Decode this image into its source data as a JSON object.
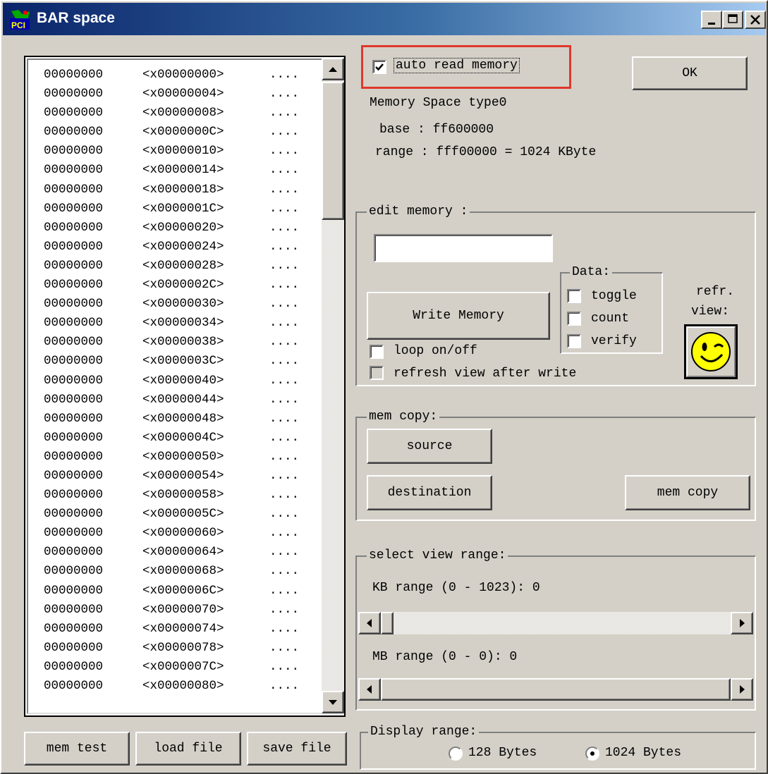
{
  "window": {
    "title": "BAR space"
  },
  "memory_list": {
    "rows": [
      {
        "value": "00000000",
        "address": "<x00000000>",
        "ascii": "...."
      },
      {
        "value": "00000000",
        "address": "<x00000004>",
        "ascii": "...."
      },
      {
        "value": "00000000",
        "address": "<x00000008>",
        "ascii": "...."
      },
      {
        "value": "00000000",
        "address": "<x0000000C>",
        "ascii": "...."
      },
      {
        "value": "00000000",
        "address": "<x00000010>",
        "ascii": "...."
      },
      {
        "value": "00000000",
        "address": "<x00000014>",
        "ascii": "...."
      },
      {
        "value": "00000000",
        "address": "<x00000018>",
        "ascii": "...."
      },
      {
        "value": "00000000",
        "address": "<x0000001C>",
        "ascii": "...."
      },
      {
        "value": "00000000",
        "address": "<x00000020>",
        "ascii": "...."
      },
      {
        "value": "00000000",
        "address": "<x00000024>",
        "ascii": "...."
      },
      {
        "value": "00000000",
        "address": "<x00000028>",
        "ascii": "...."
      },
      {
        "value": "00000000",
        "address": "<x0000002C>",
        "ascii": "...."
      },
      {
        "value": "00000000",
        "address": "<x00000030>",
        "ascii": "...."
      },
      {
        "value": "00000000",
        "address": "<x00000034>",
        "ascii": "...."
      },
      {
        "value": "00000000",
        "address": "<x00000038>",
        "ascii": "...."
      },
      {
        "value": "00000000",
        "address": "<x0000003C>",
        "ascii": "...."
      },
      {
        "value": "00000000",
        "address": "<x00000040>",
        "ascii": "...."
      },
      {
        "value": "00000000",
        "address": "<x00000044>",
        "ascii": "...."
      },
      {
        "value": "00000000",
        "address": "<x00000048>",
        "ascii": "...."
      },
      {
        "value": "00000000",
        "address": "<x0000004C>",
        "ascii": "...."
      },
      {
        "value": "00000000",
        "address": "<x00000050>",
        "ascii": "...."
      },
      {
        "value": "00000000",
        "address": "<x00000054>",
        "ascii": "...."
      },
      {
        "value": "00000000",
        "address": "<x00000058>",
        "ascii": "...."
      },
      {
        "value": "00000000",
        "address": "<x0000005C>",
        "ascii": "...."
      },
      {
        "value": "00000000",
        "address": "<x00000060>",
        "ascii": "...."
      },
      {
        "value": "00000000",
        "address": "<x00000064>",
        "ascii": "...."
      },
      {
        "value": "00000000",
        "address": "<x00000068>",
        "ascii": "...."
      },
      {
        "value": "00000000",
        "address": "<x0000006C>",
        "ascii": "...."
      },
      {
        "value": "00000000",
        "address": "<x00000070>",
        "ascii": "...."
      },
      {
        "value": "00000000",
        "address": "<x00000074>",
        "ascii": "...."
      },
      {
        "value": "00000000",
        "address": "<x00000078>",
        "ascii": "...."
      },
      {
        "value": "00000000",
        "address": "<x0000007C>",
        "ascii": "...."
      },
      {
        "value": "00000000",
        "address": "<x00000080>",
        "ascii": "...."
      }
    ]
  },
  "bottom_buttons": {
    "mem_test": "mem test",
    "load_file": "load file",
    "save_file": "save file"
  },
  "options": {
    "auto_read_label": "auto read memory",
    "auto_read_checked": true,
    "ok_label": "OK"
  },
  "info": {
    "space_type": "Memory Space type0",
    "base": "base : ff600000",
    "range": "range : fff00000 = 1024 KByte"
  },
  "edit_memory": {
    "group_label": "edit memory :",
    "input_value": "",
    "write_button": "Write Memory",
    "loop_label": "loop on/off",
    "refresh_label": "refresh view after write",
    "data_group_label": "Data:",
    "toggle_label": "toggle",
    "count_label": "count",
    "verify_label": "verify",
    "refr_label_1": "refr.",
    "refr_label_2": "view:"
  },
  "mem_copy": {
    "group_label": "mem copy:",
    "source_button": "source",
    "destination_button": "destination",
    "copy_button": "mem copy"
  },
  "view_range": {
    "group_label": "select view range:",
    "kb_label": "KB range (0 - 1023): 0",
    "mb_label": "MB range (0 - 0): 0",
    "kb_value": 0,
    "mb_value": 0
  },
  "display_range": {
    "group_label": "Display range:",
    "option_128": "128 Bytes",
    "option_1024": "1024 Bytes",
    "selected": "1024 Bytes"
  },
  "colors": {
    "highlight_box": "#e0372c",
    "title_bar_start": "#0a246a",
    "title_bar_end": "#a6caf0",
    "window_face": "#d4d0c8",
    "smiley_face": "#ffff00"
  },
  "icons": {
    "app_icon": "pci-card-icon",
    "refresh_icon": "smiley-wink-icon"
  }
}
